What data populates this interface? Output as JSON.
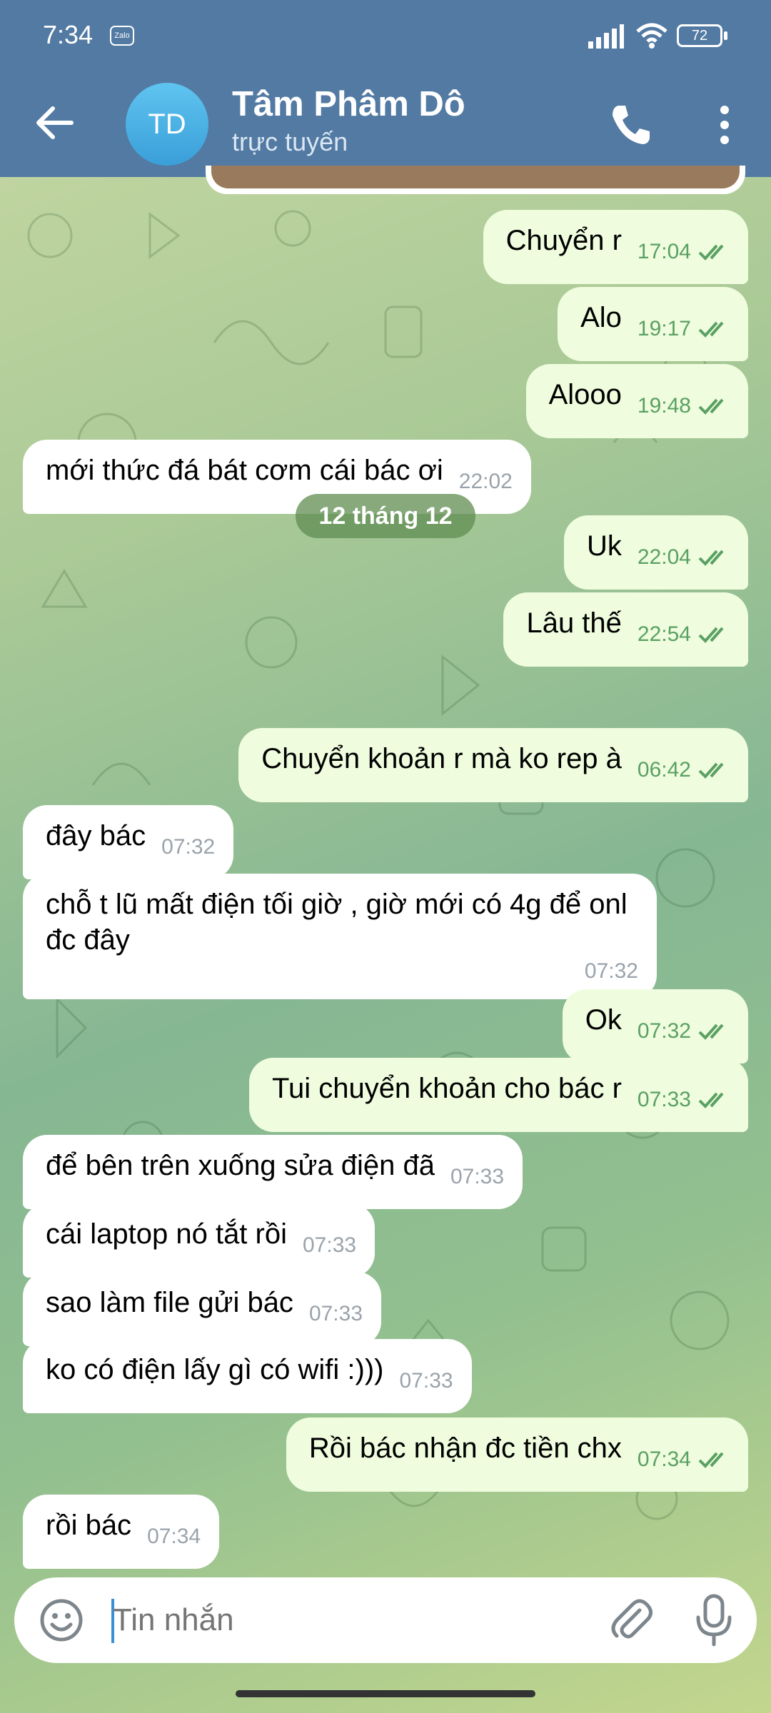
{
  "status_bar": {
    "time": "7:34",
    "app_badge": "Zalo",
    "battery": "72"
  },
  "header": {
    "contact_name": "Tâm Phâm Dô",
    "contact_initials": "TD",
    "contact_status": "trực tuyến"
  },
  "date_separator": "12 tháng 12",
  "messages": [
    {
      "text": "Chuyển r",
      "time": "17:04"
    },
    {
      "text": "Alo",
      "time": "19:17"
    },
    {
      "text": "Alooo",
      "time": "19:48"
    },
    {
      "text": "mới thức đá bát cơm cái bác ơi",
      "time": "22:02"
    },
    {
      "text": "Uk",
      "time": "22:04"
    },
    {
      "text": "Lâu thế",
      "time": "22:54"
    },
    {
      "text": "Chuyển khoản r mà ko rep à",
      "time": "06:42"
    },
    {
      "text": "đây bác",
      "time": "07:32"
    },
    {
      "text": "chỗ t lũ mất điện tối giờ , giờ mới có 4g để onl đc đây",
      "time": "07:32"
    },
    {
      "text": "Ok",
      "time": "07:32"
    },
    {
      "text": "Tui chuyển khoản cho bác r",
      "time": "07:33"
    },
    {
      "text": "để bên trên xuống sửa điện đã",
      "time": "07:33"
    },
    {
      "text": "cái laptop nó tắt rồi",
      "time": "07:33"
    },
    {
      "text": "sao làm file gửi bác",
      "time": "07:33"
    },
    {
      "text": "ko có điện lấy gì có wifi :)))",
      "time": "07:33"
    },
    {
      "text": "Rồi bác nhận đc tiền chx",
      "time": "07:34"
    },
    {
      "text": "rồi bác",
      "time": "07:34"
    }
  ],
  "input": {
    "placeholder": "Tin nhắn"
  },
  "icons": {
    "back": "arrow-left-icon",
    "call": "phone-icon",
    "menu": "more-vertical-icon",
    "emoji": "smiley-icon",
    "attach": "paperclip-icon",
    "mic": "microphone-icon",
    "read": "double-check-icon"
  },
  "colors": {
    "header": "#527aa3",
    "outgoing_bubble": "#effdde",
    "incoming_bubble": "#ffffff",
    "outgoing_meta": "#5aa063",
    "avatar": "#3a9fd8"
  }
}
